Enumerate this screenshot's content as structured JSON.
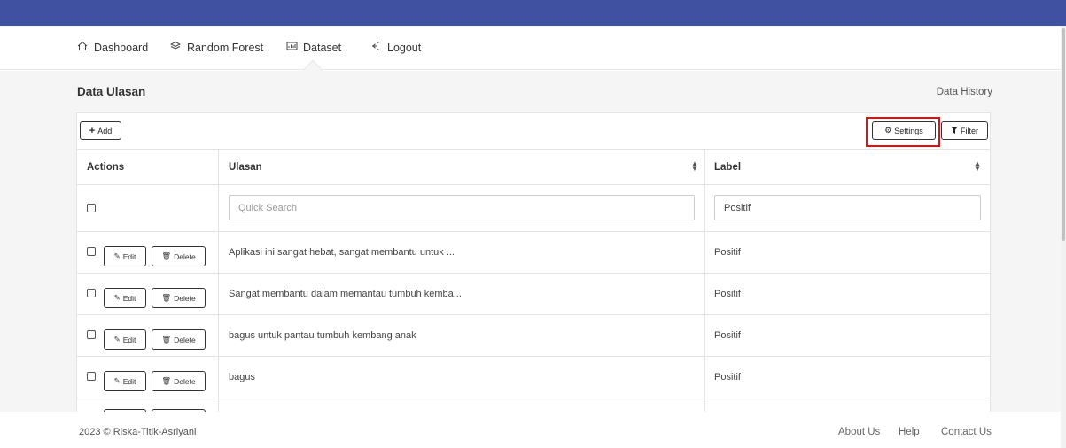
{
  "nav": {
    "items": [
      {
        "label": "Dashboard",
        "icon": "home-icon"
      },
      {
        "label": "Random Forest",
        "icon": "layers-icon"
      },
      {
        "label": "Dataset",
        "icon": "dataset-icon"
      },
      {
        "label": "Logout",
        "icon": "logout-icon"
      }
    ]
  },
  "page": {
    "title": "Data Ulasan",
    "history_link": "Data History"
  },
  "toolbar": {
    "add_label": "Add",
    "settings_label": "Settings",
    "filter_label": "Filter"
  },
  "table": {
    "headers": [
      "Actions",
      "Ulasan",
      "Label"
    ],
    "search_placeholder": "Quick Search",
    "label_filter_value": "Positif",
    "edit_label": "Edit",
    "delete_label": "Delete",
    "rows": [
      {
        "ulasan": "Aplikasi ini sangat hebat, sangat membantu untuk ...",
        "label": "Positif"
      },
      {
        "ulasan": "Sangat membantu dalam memantau tumbuh kemba...",
        "label": "Positif"
      },
      {
        "ulasan": "bagus untuk pantau tumbuh kembang anak",
        "label": "Positif"
      },
      {
        "ulasan": "bagus",
        "label": "Positif"
      }
    ]
  },
  "footer": {
    "copyright": "2023 © Riska-Titik-Asriyani",
    "links": [
      "About Us",
      "Help",
      "Contact Us"
    ]
  },
  "colors": {
    "topbar": "#3f51a0",
    "highlight": "#e01010",
    "background": "#f5f5f5"
  }
}
